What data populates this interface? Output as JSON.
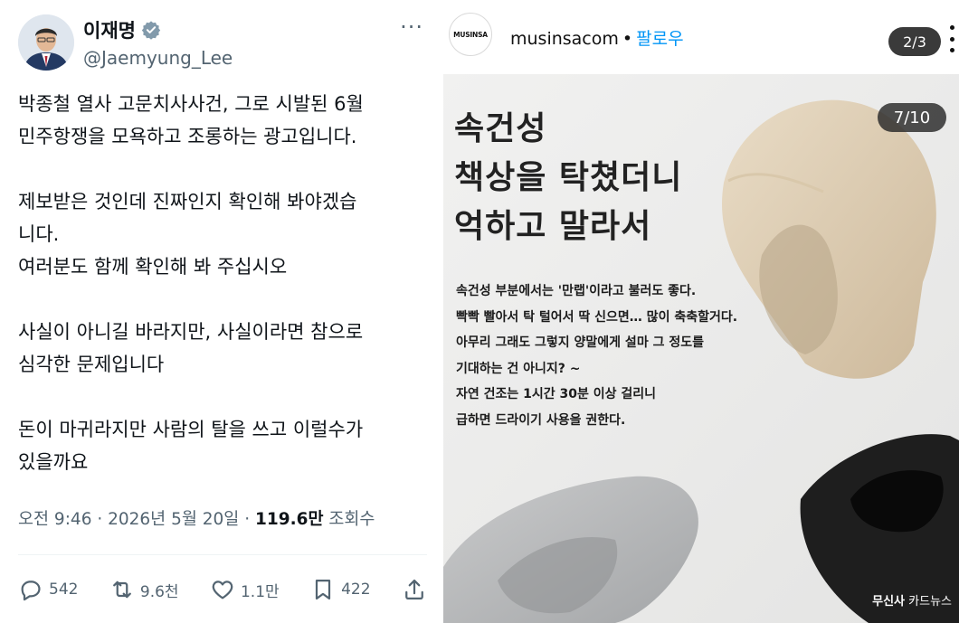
{
  "tweet": {
    "author_name": "이재명",
    "author_handle": "@Jaemyung_Lee",
    "more_label": "···",
    "lines": [
      "박종철 열사 고문치사사건, 그로 시발된 6월",
      "민주항쟁을 모욕하고 조롱하는 광고입니다.",
      "",
      "제보받은 것인데 진짜인지 확인해 봐야겠습",
      "니다.",
      "여러분도 함께 확인해 봐 주십시오",
      "",
      "사실이 아니길 바라지만, 사실이라면 참으로",
      "심각한 문제입니다",
      "",
      "돈이 마귀라지만 사람의 탈을 쓰고 이럴수가",
      "있을까요"
    ],
    "timestamp": "오전 9:46 · 2026년 5월 20일 · ",
    "views_count": "119.6만",
    "views_label": " 조회수",
    "actions": {
      "replies": "542",
      "retweets": "9.6천",
      "likes": "1.1만",
      "bookmarks": "422"
    },
    "icons": [
      "verified-badge-icon",
      "reply-icon",
      "retweet-icon",
      "like-icon",
      "bookmark-icon",
      "share-icon"
    ],
    "colors": {
      "text": "#0f1419",
      "muted": "#536471",
      "verified": "#829aab"
    }
  },
  "instagram": {
    "avatar_text": "MUSINSA",
    "username": "musinsacom",
    "separator": "•",
    "follow_label": "팔로우",
    "carousel_counter": "2/3",
    "slide": {
      "counter": "7/10",
      "headline": [
        "속건성",
        "책상을 탁쳤더니",
        "억하고 말라서"
      ],
      "caption": [
        "속건성 부분에서는 '만랩'이라고 불러도 좋다.",
        "빡빡 빨아서 탁 털어서 딱 신으면… 많이 축축할거다.",
        "아무리 그래도 그렇지 양말에게 설마 그 정도를",
        "기대하는 건 아니지? ~",
        "자연 건조는 1시간 30분 이상 걸리니",
        "급하면 드라이기 사용을 권한다."
      ],
      "brand_bold": "무신사",
      "brand_rest": " 카드뉴스"
    },
    "colors": {
      "follow": "#0095f6"
    }
  }
}
